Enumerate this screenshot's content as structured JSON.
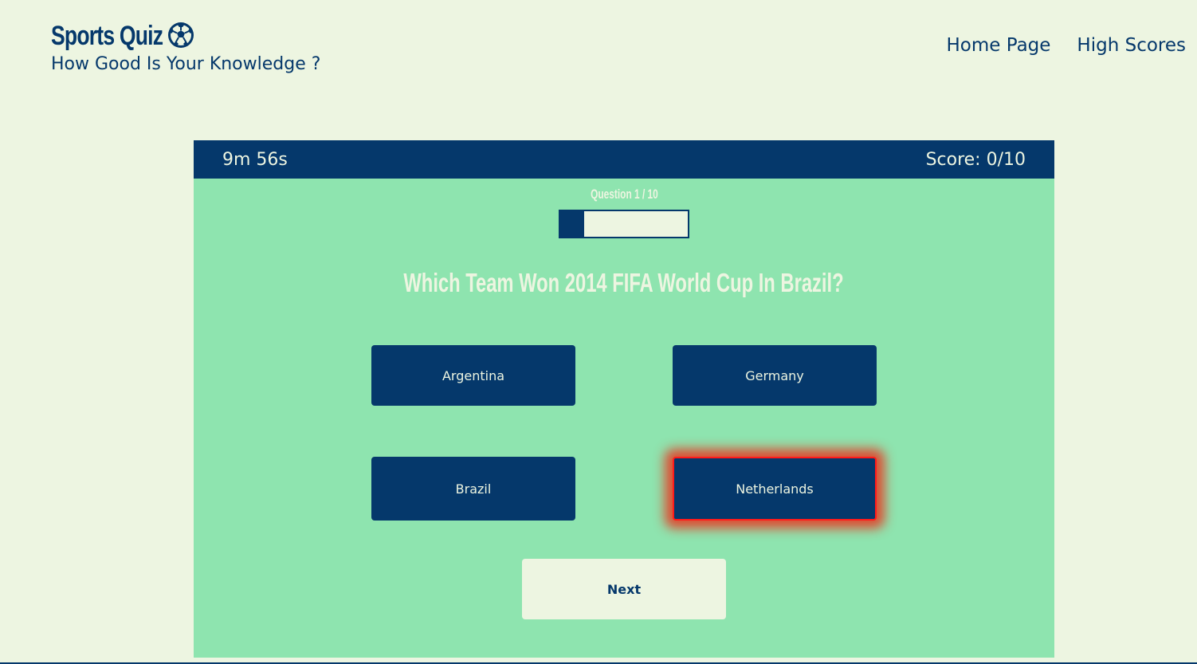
{
  "header": {
    "title": "Sports Quiz",
    "subtitle": "How Good Is Your Knowledge ?",
    "icon": "soccer-ball-icon"
  },
  "nav": {
    "items": [
      {
        "label": "Home Page"
      },
      {
        "label": "High Scores"
      }
    ]
  },
  "quiz": {
    "timer": "9m 56s",
    "score": "Score: 0/10",
    "counter": "Question 1 / 10",
    "progress": 0.1,
    "question": "Which Team Won 2014 FIFA World Cup In Brazil?",
    "answers": [
      {
        "label": "Argentina",
        "selected": false
      },
      {
        "label": "Germany",
        "selected": false
      },
      {
        "label": "Brazil",
        "selected": false
      },
      {
        "label": "Netherlands",
        "selected": true
      }
    ],
    "next_label": "Next"
  },
  "colors": {
    "background": "#edf5e1",
    "panel": "#8ee4af",
    "navy": "#05386b",
    "selected_glow": "#ff1a1a"
  }
}
